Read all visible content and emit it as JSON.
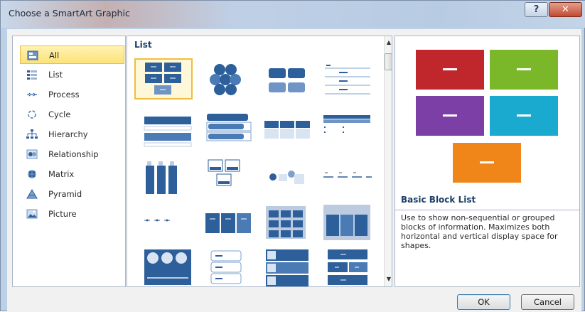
{
  "dialog": {
    "title": "Choose a SmartArt Graphic",
    "help_label": "?",
    "close_label": "✕"
  },
  "categories": [
    {
      "label": "All",
      "icon": "all-icon",
      "selected": true
    },
    {
      "label": "List",
      "icon": "list-icon"
    },
    {
      "label": "Process",
      "icon": "process-icon"
    },
    {
      "label": "Cycle",
      "icon": "cycle-icon"
    },
    {
      "label": "Hierarchy",
      "icon": "hierarchy-icon"
    },
    {
      "label": "Relationship",
      "icon": "relationship-icon"
    },
    {
      "label": "Matrix",
      "icon": "matrix-icon"
    },
    {
      "label": "Pyramid",
      "icon": "pyramid-icon"
    },
    {
      "label": "Picture",
      "icon": "picture-icon"
    }
  ],
  "gallery": {
    "header": "List",
    "selected_index": 0
  },
  "preview": {
    "title": "Basic Block List",
    "description": "Use to show non-sequential or grouped blocks of information. Maximizes both horizontal and vertical display space for shapes.",
    "block_colors": [
      "#c0272d",
      "#7ab829",
      "#7b3fa6",
      "#1aa9cf",
      "#f08519"
    ]
  },
  "buttons": {
    "ok": "OK",
    "cancel": "Cancel"
  },
  "colors": {
    "accent_blue": "#2d5f9b",
    "light_blue": "#7da1cc",
    "selection": "#fde27a"
  }
}
